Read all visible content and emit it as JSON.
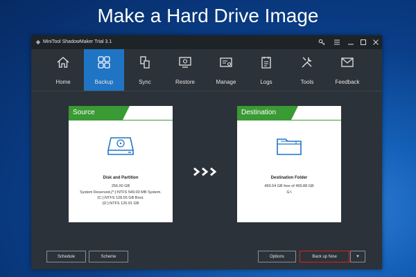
{
  "banner": {
    "title": "Make a Hard Drive Image"
  },
  "window": {
    "title": "MiniTool ShadowMaker Trial 3.1"
  },
  "nav": {
    "items": [
      {
        "label": "Home",
        "icon": "home-icon"
      },
      {
        "label": "Backup",
        "icon": "backup-icon",
        "active": true
      },
      {
        "label": "Sync",
        "icon": "sync-icon"
      },
      {
        "label": "Restore",
        "icon": "restore-icon"
      },
      {
        "label": "Manage",
        "icon": "manage-icon"
      },
      {
        "label": "Logs",
        "icon": "logs-icon"
      },
      {
        "label": "Tools",
        "icon": "tools-icon"
      },
      {
        "label": "Feedback",
        "icon": "feedback-icon"
      }
    ]
  },
  "source": {
    "tab": "Source",
    "heading": "Disk and Partition",
    "size": "256.00 GB",
    "details": [
      "System Reserved,(*:):NTFS 549.00 MB System.",
      "(C:):NTFS 128.55 GB Boot.",
      "(D:):NTFS 126.91 GB"
    ]
  },
  "destination": {
    "tab": "Destination",
    "heading": "Destination Folder",
    "free": "499.54 GB free of 499.88 GB",
    "path": "G:\\"
  },
  "buttons": {
    "schedule": "Schedule",
    "scheme": "Scheme",
    "options": "Options",
    "backup_now": "Back up Now"
  },
  "colors": {
    "accent_blue": "#1f74c4",
    "tab_green": "#3a9a34",
    "window_bg": "#2b3239",
    "highlight_red": "#e02020"
  }
}
